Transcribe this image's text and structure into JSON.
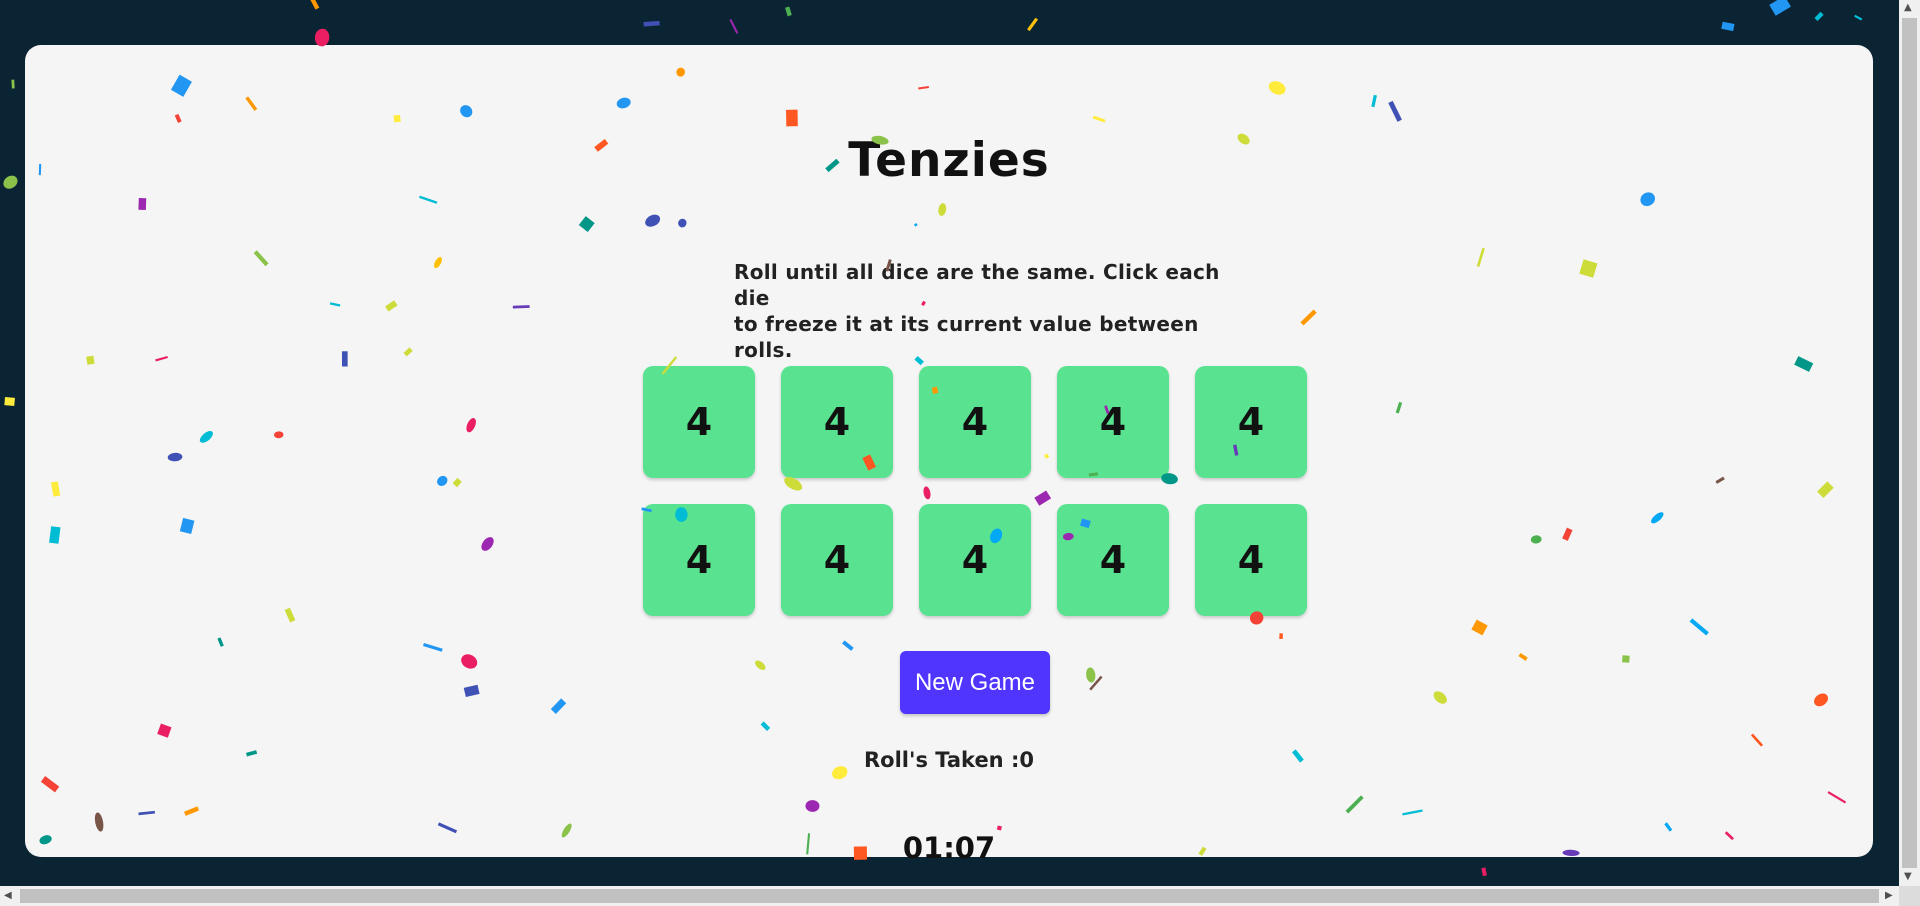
{
  "game": {
    "title": "Tenzies",
    "instructions_line1": "Roll until all dice are the same. Click each die",
    "instructions_line2": "to freeze it at its current value between rolls.",
    "dice": [
      "4",
      "4",
      "4",
      "4",
      "4",
      "4",
      "4",
      "4",
      "4",
      "4"
    ],
    "new_game_label": "New Game",
    "rolls_label": "Roll's Taken :0",
    "timer": "01:07",
    "colors": {
      "page_background": "#0b2434",
      "card_background": "#f5f5f5",
      "die_color": "#59e391",
      "button_color": "#5035ff"
    }
  },
  "scrollbars": {
    "up_arrow": "▲",
    "down_arrow": "▼",
    "left_arrow": "◀",
    "right_arrow": "▶"
  },
  "confetti_colors": [
    "#f44336",
    "#e91e63",
    "#9c27b0",
    "#673ab7",
    "#3f51b5",
    "#2196f3",
    "#03a9f4",
    "#00bcd4",
    "#009688",
    "#4caf50",
    "#8bc34a",
    "#cddc39",
    "#ffeb3b",
    "#ffc107",
    "#ff9800",
    "#ff5722",
    "#795548"
  ]
}
